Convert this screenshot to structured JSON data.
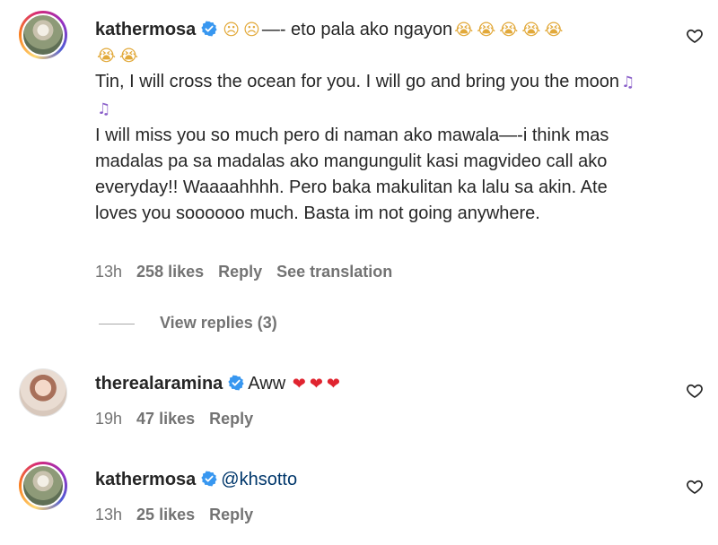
{
  "comments": [
    {
      "username": "kathermosa",
      "header_rest": "—- eto pala ako ngayon",
      "paragraph_1": "Tin, I will cross the ocean for you. I will go and bring you the moon",
      "paragraph_2": "I will miss you so much pero di naman ako mawala—-i think mas madalas pa sa madalas ako mangungulit kasi magvideo call ako everyday!! Waaaahhhh. Pero baka makulitan ka lalu sa akin. Ate loves you soooooo much. Basta im not going anywhere.",
      "time": "13h",
      "likes": "258 likes",
      "reply": "Reply",
      "translate": "See translation",
      "view_replies": "View replies (3)"
    },
    {
      "username": "therealaramina",
      "text": "Aww",
      "time": "19h",
      "likes": "47 likes",
      "reply": "Reply"
    },
    {
      "username": "kathermosa",
      "text": "@khsotto",
      "time": "13h",
      "likes": "25 likes",
      "reply": "Reply"
    }
  ],
  "icons": {
    "verified_color": "#3897f0",
    "like": "heart-outline-icon",
    "emoji_cry": "loudly-crying-face",
    "emoji_sad": "worried-face",
    "emoji_music": "musical-notes",
    "emoji_heart": "red-heart"
  }
}
